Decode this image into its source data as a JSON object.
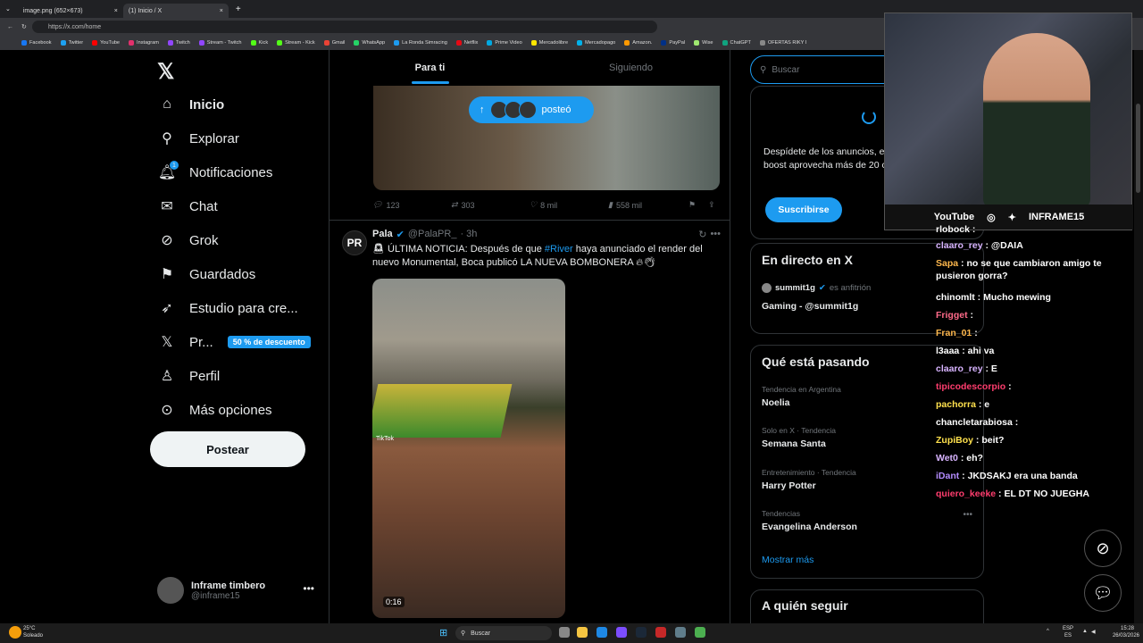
{
  "browser": {
    "tabs": [
      {
        "label": "image.png (652×673)"
      },
      {
        "label": "(1) Inicio / X"
      }
    ],
    "url": "https://x.com/home",
    "bookmarks": [
      "Facebook",
      "Twitter",
      "YouTube",
      "Instagram",
      "Twitch",
      "Stream - Twitch",
      "Kick",
      "Stream - Kick",
      "Gmail",
      "WhatsApp",
      "La Ronda Simracing",
      "Netflix",
      "Prime Video",
      "Mercadolibre",
      "Mercadopago",
      "Amazon.",
      "PayPal",
      "Wise",
      "ChatGPT",
      "OFERTAS RIKY I"
    ]
  },
  "sidebar": {
    "items": [
      {
        "label": "Inicio"
      },
      {
        "label": "Explorar"
      },
      {
        "label": "Notificaciones"
      },
      {
        "label": "Chat"
      },
      {
        "label": "Grok"
      },
      {
        "label": "Guardados"
      },
      {
        "label": "Estudio para cre..."
      },
      {
        "label": "Pr..."
      },
      {
        "label": "Perfil"
      },
      {
        "label": "Más opciones"
      }
    ],
    "notification_badge": "1",
    "premium_badge": "50 % de descuento",
    "post_button": "Postear",
    "account": {
      "name": "Inframe timbero",
      "handle": "@inframe15"
    }
  },
  "feed": {
    "tabs": [
      "Para ti",
      "Siguiendo"
    ],
    "posted_pill": "posteó",
    "first_post_stats": {
      "replies": "123",
      "reposts": "303",
      "likes": "8 mil",
      "views": "558 mil"
    },
    "post": {
      "avatar_text": "PR",
      "name": "Pala",
      "handle": "@PalaPR_",
      "time": "· 3h",
      "text_before": "ÚLTIMA NOTICIA: Después de que ",
      "hashtag": "#River",
      "text_after": " haya anunciado el render del nuevo Monumental, Boca publicó LA NUEVA BOMBONERA",
      "watermark": "TikTok",
      "duration": "0:16"
    }
  },
  "right": {
    "search_placeholder": "Buscar",
    "premium_text": "Despídete de los anuncios, estadísticas, aplica boost aprovecha más de 20 cara",
    "subscribe": "Suscribirse",
    "live": {
      "title": "En directo en X",
      "host": "summit1g",
      "host_role": "es anfitrión",
      "stream": "Gaming - @summit1g"
    },
    "trends_title": "Qué está pasando",
    "trends": [
      {
        "context": "Tendencia en Argentina",
        "topic": "Noelia"
      },
      {
        "context": "Solo en X · Tendencia",
        "topic": "Semana Santa"
      },
      {
        "context": "Entretenimiento · Tendencia",
        "topic": "Harry Potter"
      },
      {
        "context": "Tendencias",
        "topic": "Evangelina Anderson"
      }
    ],
    "show_more": "Mostrar más",
    "who_to_follow": "A quién seguir"
  },
  "overlay": {
    "webcam_bar": {
      "youtube": "YouTube",
      "channel": "INFRAME15"
    },
    "chat": [
      {
        "user": "rlobock",
        "text": ":",
        "color": "#ffffff"
      },
      {
        "user": "claaro_rey",
        "text": ": @DAIA",
        "color": "#d8b4ff"
      },
      {
        "user": "Sapa",
        "text": ": no se que cambiaron amigo te pusieron gorra?",
        "color": "#ffb84d"
      },
      {
        "user": "chinomlt",
        "text": ": Mucho mewing",
        "color": "#ffffff"
      },
      {
        "user": "Frigget",
        "text": ":",
        "color": "#ff6b8a"
      },
      {
        "user": "Fran_01",
        "text": ":",
        "color": "#ffb84d"
      },
      {
        "user": "l3aaa",
        "text": ": ahi va",
        "color": "#ffffff"
      },
      {
        "user": "claaro_rey",
        "text": ": E",
        "color": "#d8b4ff"
      },
      {
        "user": "tipicodescorpio",
        "text": ":",
        "color": "#ff3d6e"
      },
      {
        "user": "pachorra",
        "text": ": e",
        "color": "#ffe14d"
      },
      {
        "user": "chancletarabiosa",
        "text": ":",
        "color": "#ffffff"
      },
      {
        "user": "ZupiBoy",
        "text": ": beit?",
        "color": "#ffe14d"
      },
      {
        "user": "Wet0",
        "text": ": eh?",
        "color": "#d8b4ff"
      },
      {
        "user": "iDant",
        "text": ": JKDSAKJ era una banda",
        "color": "#b48cff"
      },
      {
        "user": "quiero_keeke",
        "text": ": EL DT NO JUEGHA",
        "color": "#ff3d6e"
      }
    ]
  },
  "taskbar": {
    "weather_temp": "25°C",
    "weather_text": "Soleado",
    "search": "Buscar",
    "lang": "ESP",
    "region": "ES",
    "time": "15:28",
    "date": "26/03/2026"
  },
  "colors": {
    "accent": "#1d9bf0",
    "background": "#000000",
    "border": "#2f3336",
    "muted": "#71767b"
  }
}
